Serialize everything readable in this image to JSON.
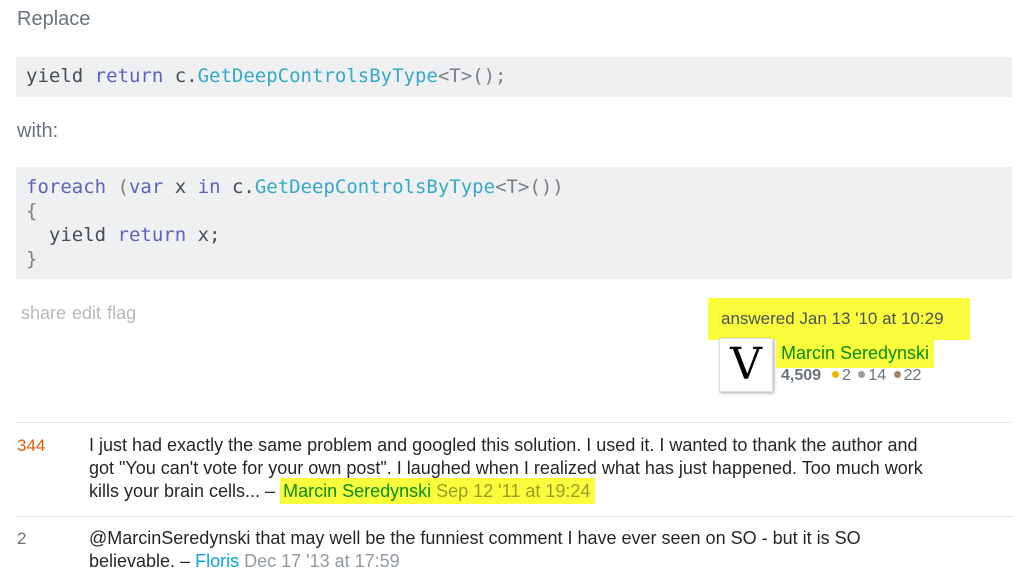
{
  "replace_label": "Replace",
  "code1": {
    "p1": "yield ",
    "p2": "return",
    "p3": " c.",
    "p4": "GetDeepControlsByType",
    "p5": "<T>();"
  },
  "with_label": "with:",
  "code2": {
    "l1a": "foreach",
    "l1b": " (",
    "l1c": "var",
    "l1d": " x ",
    "l1e": "in",
    "l1f": " c.",
    "l1g": "GetDeepControlsByType",
    "l1h": "<T>())",
    "l2": "{",
    "l3a": "  yield ",
    "l3b": "return",
    "l3c": " x;",
    "l4": "}"
  },
  "menu": {
    "share": "share",
    "edit": "edit",
    "flag": "flag"
  },
  "signature": {
    "action_time": "answered Jan 13 '10 at 10:29",
    "avatar_letter": "V",
    "username": "Marcin Seredynski",
    "reputation": "4,509",
    "gold": "2",
    "silver": "14",
    "bronze": "22",
    "gold_color": "#f1b600",
    "silver_color": "#9a9c9f",
    "bronze_color": "#ab825f"
  },
  "comments": [
    {
      "score": "344",
      "score_color": "#e25e02",
      "line1": "I just had exactly the same problem and googled this solution. I used it. I wanted to thank the author and",
      "line2": "got \"You can't vote for your own post\". I laughed when I realized what has just happened. Too much work",
      "line3": "kills your brain cells... – ",
      "user": "Marcin Seredynski",
      "date": "Sep 12 '11 at 19:24"
    },
    {
      "score": "2",
      "score_color": "#6a737c",
      "line1": "@MarcinSeredynski that may well be the funniest comment I have ever seen on SO - but it is SO",
      "line2": "believable. – ",
      "user": "Floris",
      "date": "Dec 17 '13 at 17:59"
    }
  ]
}
